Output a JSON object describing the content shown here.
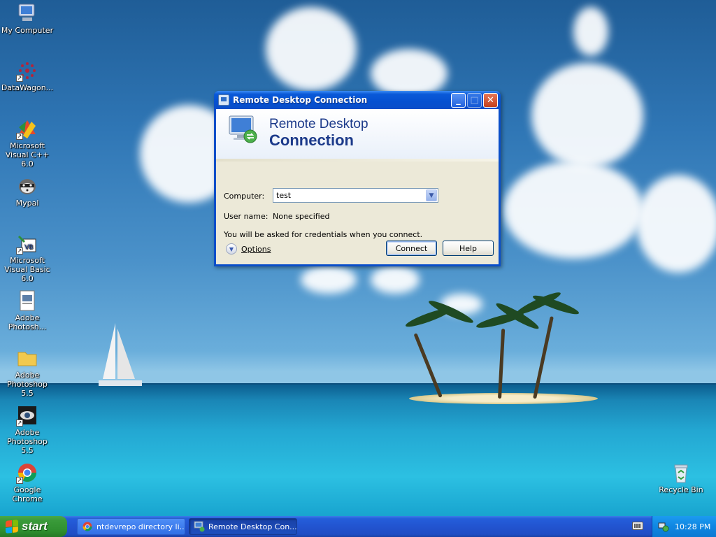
{
  "desktop": {
    "icons": [
      {
        "label": "My Computer",
        "icon": "my-computer-icon"
      },
      {
        "label": "DataWagon...",
        "icon": "datawagon-icon"
      },
      {
        "label": "Microsoft Visual C++ 6.0",
        "icon": "visual-cpp-icon"
      },
      {
        "label": "Mypal",
        "icon": "mypal-icon"
      },
      {
        "label": "Microsoft Visual Basic 6.0",
        "icon": "visual-basic-icon"
      },
      {
        "label": "Adobe Photosh...",
        "icon": "photoshop-file-icon"
      },
      {
        "label": "Adobe Photoshop 5.5",
        "icon": "folder-icon"
      },
      {
        "label": "Adobe Photoshop 5.5",
        "icon": "photoshop-eye-icon"
      },
      {
        "label": "Google Chrome",
        "icon": "chrome-icon"
      }
    ],
    "recycle_bin": {
      "label": "Recycle Bin",
      "icon": "recycle-bin-icon"
    }
  },
  "dialog": {
    "title": "Remote Desktop Connection",
    "banner_line1": "Remote Desktop",
    "banner_line2": "Connection",
    "computer_label": "Computer:",
    "computer_value": "test",
    "username_label": "User name:",
    "username_value": "None specified",
    "credentials_note": "You will be asked for credentials when you connect.",
    "options_label": "Options",
    "connect_label": "Connect",
    "help_label": "Help",
    "minimize_glyph": "_",
    "maximize_glyph": "□",
    "close_glyph": "✕"
  },
  "taskbar": {
    "start_label": "start",
    "tasks": [
      {
        "label": "ntdevrepo directory li...",
        "icon": "chrome-icon",
        "active": false
      },
      {
        "label": "Remote Desktop Con...",
        "icon": "remote-desktop-icon",
        "active": true
      }
    ],
    "clock": "10:28 PM"
  },
  "colors": {
    "xp_blue": "#0a4ec9",
    "start_green": "#3a9b3a",
    "dialog_face": "#ece9d8",
    "banner_text": "#1c3a8a"
  }
}
